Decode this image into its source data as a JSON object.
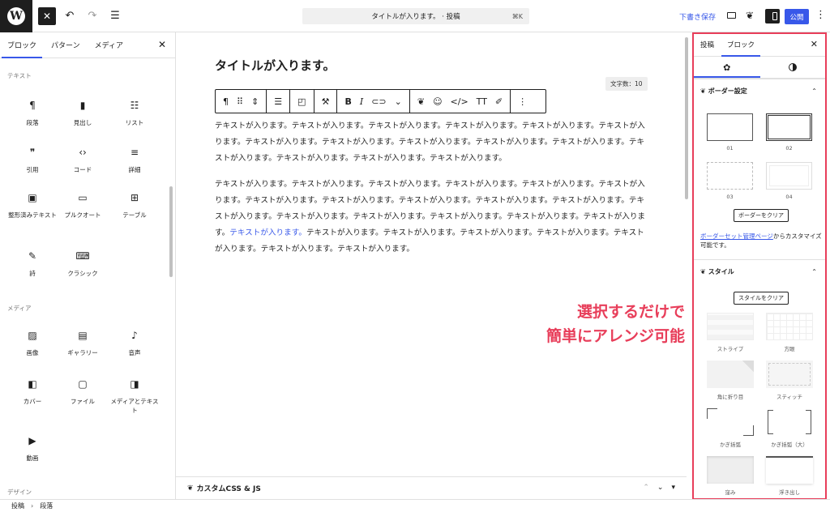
{
  "topbar": {
    "logo": "W",
    "close_glyph": "✕",
    "undo_glyph": "↶",
    "redo_glyph": "↷",
    "list_view_glyph": "☰",
    "command_bar_label": "タイトルが入ります。 · 投稿",
    "command_shortcut": "⌘K",
    "save_draft_label": "下書き保存",
    "plugin_glyph": "❦",
    "publish_label": "公開",
    "more_glyph": "⋮"
  },
  "inserter": {
    "tabs": [
      "ブロック",
      "パターン",
      "メディア"
    ],
    "close_glyph": "✕",
    "categories": {
      "text": "テキスト",
      "media": "メディア",
      "design": "デザイン"
    },
    "text_blocks": [
      {
        "icon": "¶",
        "label": "段落"
      },
      {
        "icon": "▮",
        "label": "見出し"
      },
      {
        "icon": "☷",
        "label": "リスト"
      },
      {
        "icon": "❞",
        "label": "引用"
      },
      {
        "icon": "‹›",
        "label": "コード"
      },
      {
        "icon": "≡",
        "label": "詳細"
      },
      {
        "icon": "▣",
        "label": "整形済みテキスト"
      },
      {
        "icon": "▭",
        "label": "プルクオート"
      },
      {
        "icon": "⊞",
        "label": "テーブル"
      },
      {
        "icon": "✎",
        "label": "詩"
      },
      {
        "icon": "⌨",
        "label": "クラシック"
      }
    ],
    "media_blocks": [
      {
        "icon": "▨",
        "label": "画像"
      },
      {
        "icon": "▤",
        "label": "ギャラリー"
      },
      {
        "icon": "♪",
        "label": "音声"
      },
      {
        "icon": "◧",
        "label": "カバー"
      },
      {
        "icon": "▢",
        "label": "ファイル"
      },
      {
        "icon": "◨",
        "label": "メディアとテキスト"
      },
      {
        "icon": "▶",
        "label": "動画"
      }
    ]
  },
  "canvas": {
    "title": "タイトルが入ります。",
    "char_count": "文字数：10",
    "toolbar": {
      "paragraph": "¶",
      "drag": "⠿",
      "move": "⇕",
      "align": "☰",
      "style1": "◰",
      "style2": "⚒",
      "bold": "B",
      "italic": "I",
      "link": "⊂⊃",
      "more_arrow": "⌄",
      "plugin": "❦",
      "emoji": "☺",
      "code": "</>",
      "text_size": "TT",
      "highlight": "✐",
      "options": "⋮"
    },
    "paragraph1": "テキストが入ります。テキストが入ります。テキストが入ります。テキストが入ります。テキストが入ります。テキストが入ります。テキストが入ります。テキストが入ります。テキストが入ります。テキストが入ります。テキストが入ります。テキストが入ります。テキストが入ります。テキストが入ります。テキストが入ります。",
    "paragraph2_before": "テキストが入ります。テキストが入ります。テキストが入ります。テキストが入ります。テキストが入ります。テキストが入ります。テキストが入ります。テキストが入ります。テキストが入ります。テキストが入ります。テキストが入ります。テキストが入ります。テキストが入ります。テキストが入ります。テキストが入ります。テキストが入ります。テキストが入ります。",
    "paragraph2_link": "テキストが入ります。",
    "paragraph2_after": "テキストが入ります。テキストが入ります。テキストが入ります。テキストが入ります。テキストが入ります。テキストが入ります。テキストが入ります。",
    "custom_css_label": "カスタムCSS & JS",
    "custom_css_icon": "❦",
    "up_glyph": "⌃",
    "down_glyph": "⌄",
    "toggle_glyph": "▾"
  },
  "overlay": {
    "line1": "選択するだけで",
    "line2": "簡単にアレンジ可能"
  },
  "sidebar": {
    "tabs": [
      "投稿",
      "ブロック"
    ],
    "close_glyph": "✕",
    "settings_glyph": "✿",
    "border_section": {
      "icon": "❦",
      "title": "ボーダー設定",
      "chevron": "⌃",
      "presets": [
        "01",
        "02",
        "03",
        "04"
      ],
      "clear_label": "ボーダーをクリア",
      "note_link": "ボーダーセット管理ページ",
      "note_text": "からカスタマイズ可能です。"
    },
    "style_section": {
      "icon": "❦",
      "title": "スタイル",
      "chevron": "⌃",
      "clear_label": "スタイルをクリア",
      "styles": [
        "ストライプ",
        "方眼",
        "角に折り目",
        "スティッチ",
        "かぎ括弧",
        "かぎ括弧（大）",
        "窪み",
        "浮き出し"
      ]
    }
  },
  "footer": {
    "crumb1": "投稿",
    "separator": "›",
    "crumb2": "段落"
  },
  "colors": {
    "accent": "#3858e9",
    "highlight": "#e83e5a",
    "dark": "#1e1e1e"
  }
}
